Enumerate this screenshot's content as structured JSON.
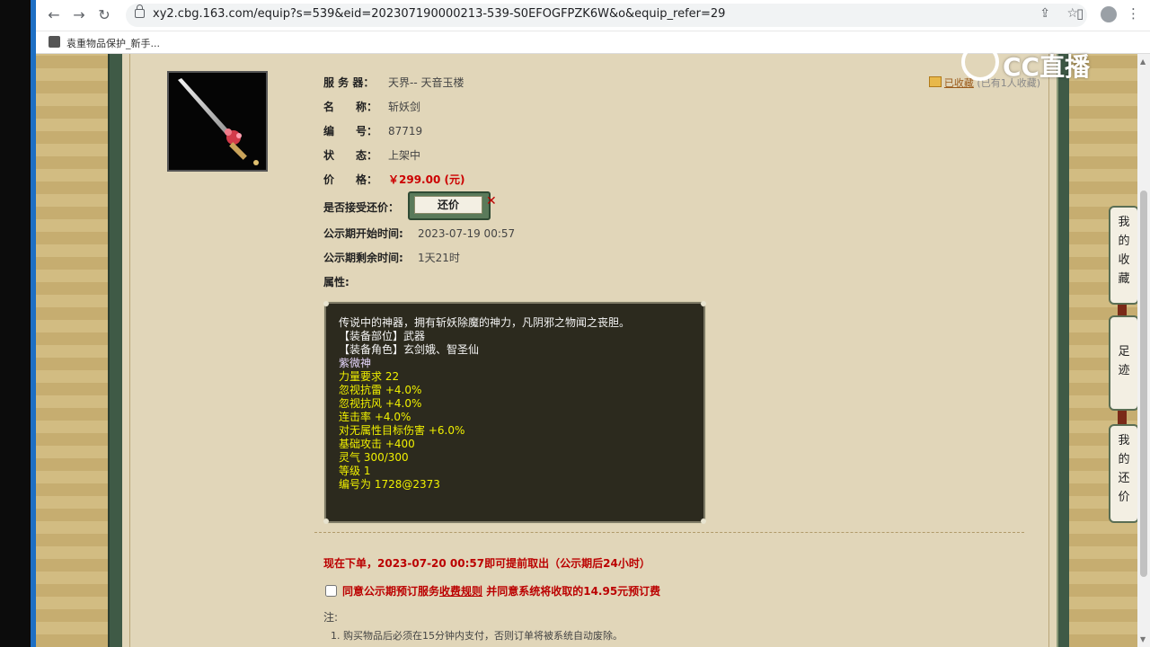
{
  "browser": {
    "url": "xy2.cbg.163.com/equip?s=539&eid=202307190000213-539-S0EFOGFPZK6W&o&equip_refer=29",
    "bookmark": "袁重物品保护_新手..."
  },
  "watermark": "CC直播",
  "item": {
    "server_label": "服 务 器：",
    "server_value": "天界-- 天音玉楼",
    "name_label": "名　　称：",
    "name_value": "斩妖剑",
    "id_label": "编　　号：",
    "id_value": "87719",
    "status_label": "状　　态：",
    "status_value": "上架中",
    "price_label": "价　　格：",
    "price_value": "￥299.00 (元)",
    "counter_label": "是否接受还价：",
    "counter_button": "还价",
    "public_start_label": "公示期开始时间:",
    "public_start_value": "2023-07-19 00:57",
    "public_remain_label": "公示期剩余时间:",
    "public_remain_value": "1天21时",
    "attr_label": "属性:"
  },
  "favorite": {
    "link": "已收藏",
    "count": "(已有1人收藏)"
  },
  "properties": [
    "传说中的神器，拥有斩妖除魔的神力，凡阴邪之物闻之丧胆。",
    "【装备部位】武器",
    "【装备角色】玄剑娥、智圣仙",
    "紫微神",
    "力量要求 22",
    "忽视抗雷 +4.0%",
    "忽视抗风 +4.0%",
    "连击率 +4.0%",
    "对无属性目标伤害 +6.0%",
    "基础攻击 +400",
    "灵气 300/300",
    "等级 1",
    "编号为 1728@2373"
  ],
  "notice": "现在下单，2023-07-20 00:57即可提前取出（公示期后24小时）",
  "agree": {
    "prefix": "同意公示期预订服务",
    "rule_link": "收费规则",
    "suffix": "并同意系统将收取的14.95元预订费"
  },
  "notes": {
    "label": "注:",
    "item1": "1. 购买物品后必须在15分钟内支付，否则订单将被系统自动废除。"
  },
  "side_tabs": [
    "我的收藏",
    "足迹",
    "我的还价"
  ]
}
